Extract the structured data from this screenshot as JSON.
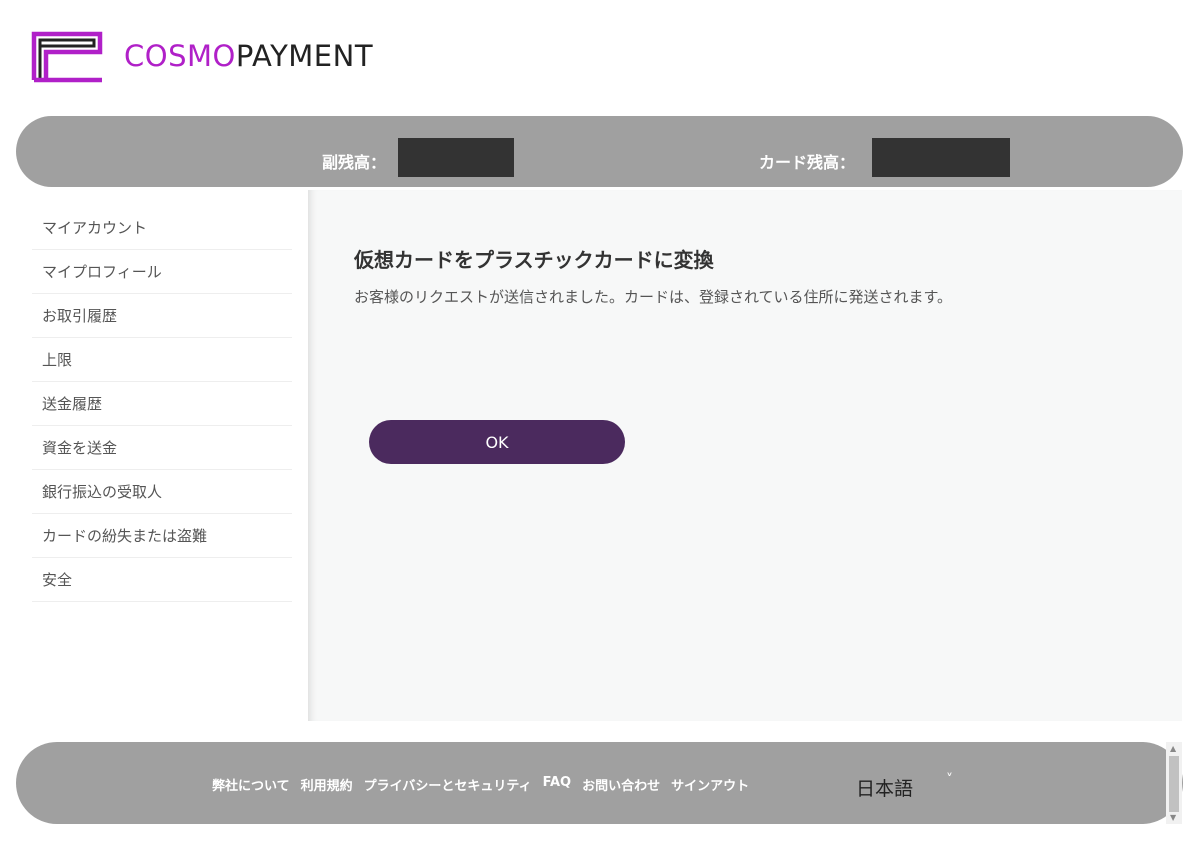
{
  "brand": {
    "name_part1": "COSMO",
    "name_part2": "PAYMENT",
    "accent_color": "#b020c8"
  },
  "balance_bar": {
    "sub_balance_label": "副残高：",
    "card_balance_label": "カード残高："
  },
  "sidebar": {
    "items": [
      {
        "label": "マイアカウント"
      },
      {
        "label": "マイプロフィール"
      },
      {
        "label": "お取引履歴"
      },
      {
        "label": "上限"
      },
      {
        "label": "送金履歴"
      },
      {
        "label": "資金を送金"
      },
      {
        "label": "銀行振込の受取人"
      },
      {
        "label": "カードの紛失または盗難"
      },
      {
        "label": "安全"
      }
    ]
  },
  "main": {
    "title": "仮想カードをプラスチックカードに変換",
    "message": "お客様のリクエストが送信されました。カードは、登録されている住所に発送されます。",
    "ok_label": "OK",
    "button_color": "#4b2a5e"
  },
  "footer": {
    "links": [
      {
        "label": "弊社について"
      },
      {
        "label": "利用規約"
      },
      {
        "label": "プライバシーとセキュリティ"
      },
      {
        "label": "FAQ"
      },
      {
        "label": "お問い合わせ"
      },
      {
        "label": "サインアウト"
      }
    ],
    "language": "日本語",
    "language_icon": "chevron-down-icon"
  }
}
